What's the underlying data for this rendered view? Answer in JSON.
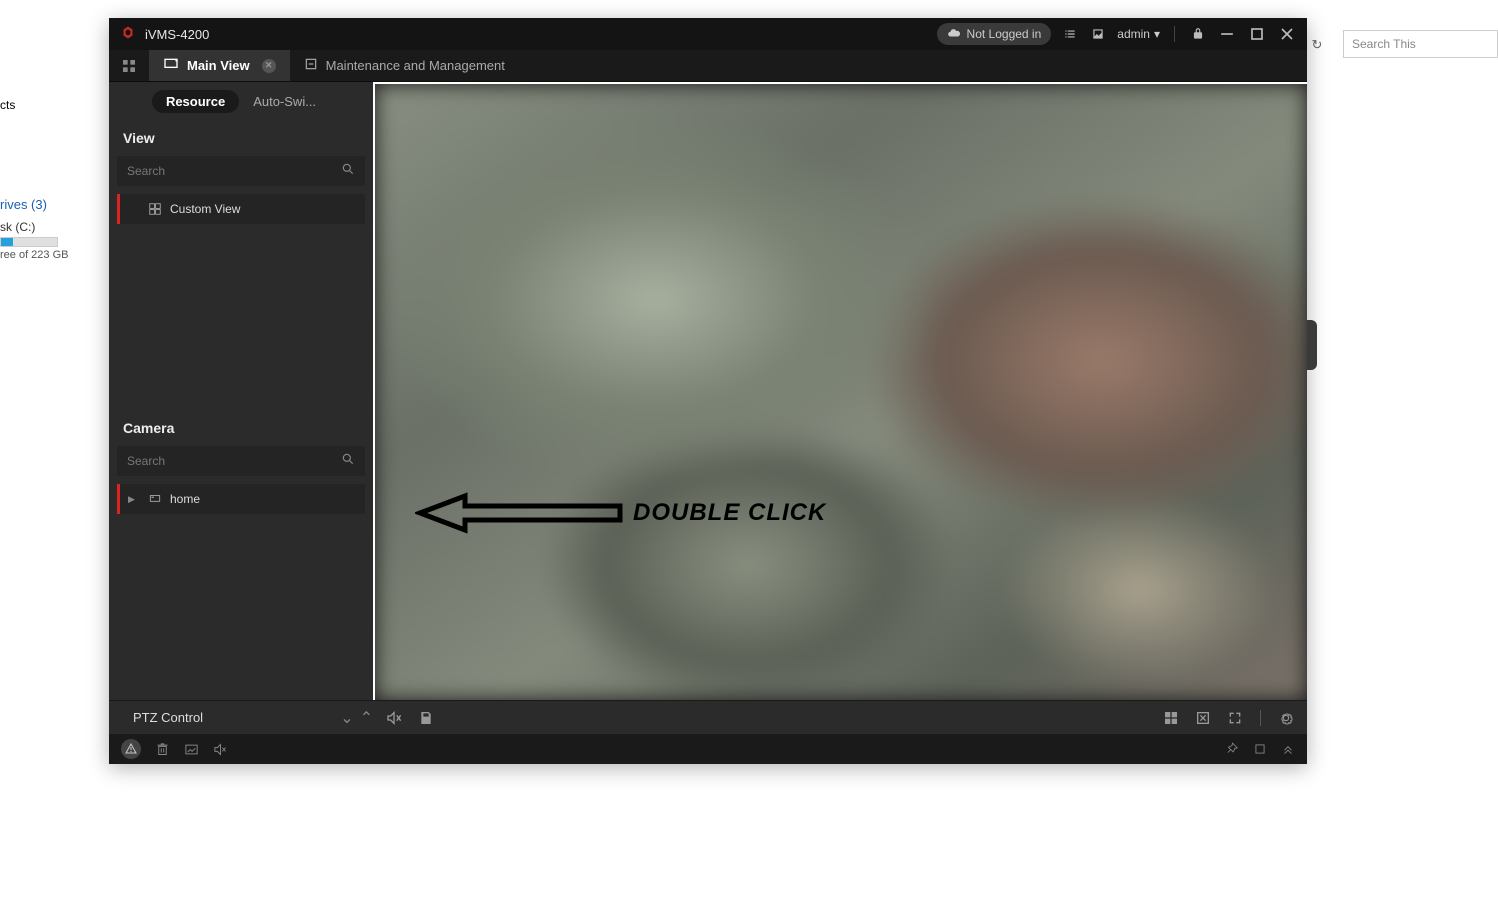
{
  "desktop": {
    "cts_label": "cts",
    "drives_label": "rives (3)",
    "disk_label": "sk (C:)",
    "disk_free_label": "ree of 223 GB",
    "search_placeholder": "Search This"
  },
  "app": {
    "title": "iVMS-4200",
    "login_status": "Not Logged in",
    "user_name": "admin"
  },
  "tabs": {
    "main_view": "Main View",
    "maintenance": "Maintenance and Management"
  },
  "subtabs": {
    "resource": "Resource",
    "autoswitch": "Auto-Swi..."
  },
  "sidebar": {
    "view_header": "View",
    "view_search_placeholder": "Search",
    "custom_view_label": "Custom View",
    "camera_header": "Camera",
    "camera_search_placeholder": "Search",
    "home_label": "home"
  },
  "bottom": {
    "ptz_label": "PTZ Control"
  },
  "annotation": {
    "text": "DOUBLE CLICK"
  }
}
